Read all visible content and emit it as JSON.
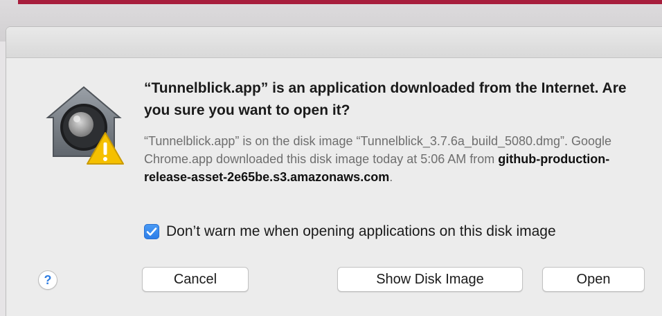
{
  "dialog": {
    "headline": "“Tunnelblick.app” is an application downloaded from the Internet. Are you sure you want to open it?",
    "info": {
      "part1": "“Tunnelblick.app” is on the disk image “Tunnelblick_3.7.6a_build_5080.dmg”. Google Chrome.app downloaded this disk image today at 5:06 AM from ",
      "source": "github-production-release-asset-2e65be.s3.amazonaws.com",
      "part2": "."
    },
    "checkbox": {
      "label": "Don’t warn me when opening applications on this disk image",
      "checked": true
    },
    "buttons": {
      "help": "?",
      "cancel": "Cancel",
      "show_disk_image": "Show Disk Image",
      "open": "Open"
    },
    "icons": {
      "app_icon": "gatekeeper-icon",
      "warning_badge": "warning-icon",
      "checkmark": "checkmark-icon"
    },
    "colors": {
      "accent": "#2c7de8",
      "warning": "#f5c000",
      "top_stripe": "#a71d3c"
    }
  }
}
